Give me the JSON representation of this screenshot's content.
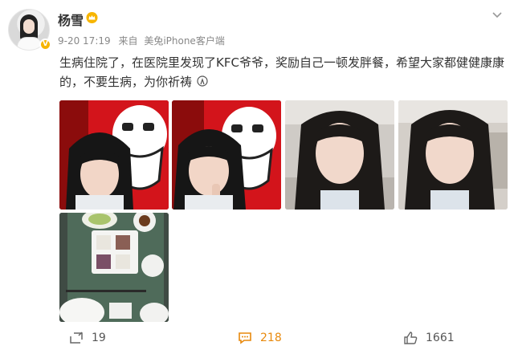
{
  "post": {
    "username": "杨雪",
    "date_time": "9-20 17:19",
    "source_prefix": "来自",
    "source_device": "美兔iPhone客户端",
    "content": "生病住院了，在医院里发现了KFC爷爷，奖励自己一顿发胖餐，希望大家都健健康康的，不要生病，为你祈祷"
  },
  "stats": {
    "reposts": "19",
    "comments": "218",
    "likes": "1661"
  },
  "colors": {
    "comment_accent": "#e8890c",
    "verified_badge": "#f7b500",
    "kfc_red": "#d3141b"
  },
  "icons": [
    "crown-icon",
    "chevron-down-icon",
    "verified-icon",
    "repost-icon",
    "comment-icon",
    "like-icon",
    "praying-emoji-icon"
  ]
}
